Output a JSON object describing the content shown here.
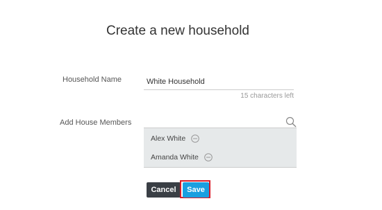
{
  "page": {
    "title": "Create a new household"
  },
  "form": {
    "name_label": "Household Name",
    "name_value": "White Household",
    "char_counter": "15 characters left",
    "members_label": "Add House Members",
    "search_icon": "search-icon",
    "members": [
      {
        "name": "Alex White",
        "icon": "remove-circle-icon"
      },
      {
        "name": "Amanda White",
        "icon": "remove-circle-icon"
      }
    ]
  },
  "actions": {
    "cancel_label": "Cancel",
    "save_label": "Save"
  },
  "colors": {
    "cancel_bg": "#3a3f45",
    "save_bg": "#1a9fe0",
    "highlight": "#d81b28",
    "member_list_bg": "#e6e9ea"
  }
}
